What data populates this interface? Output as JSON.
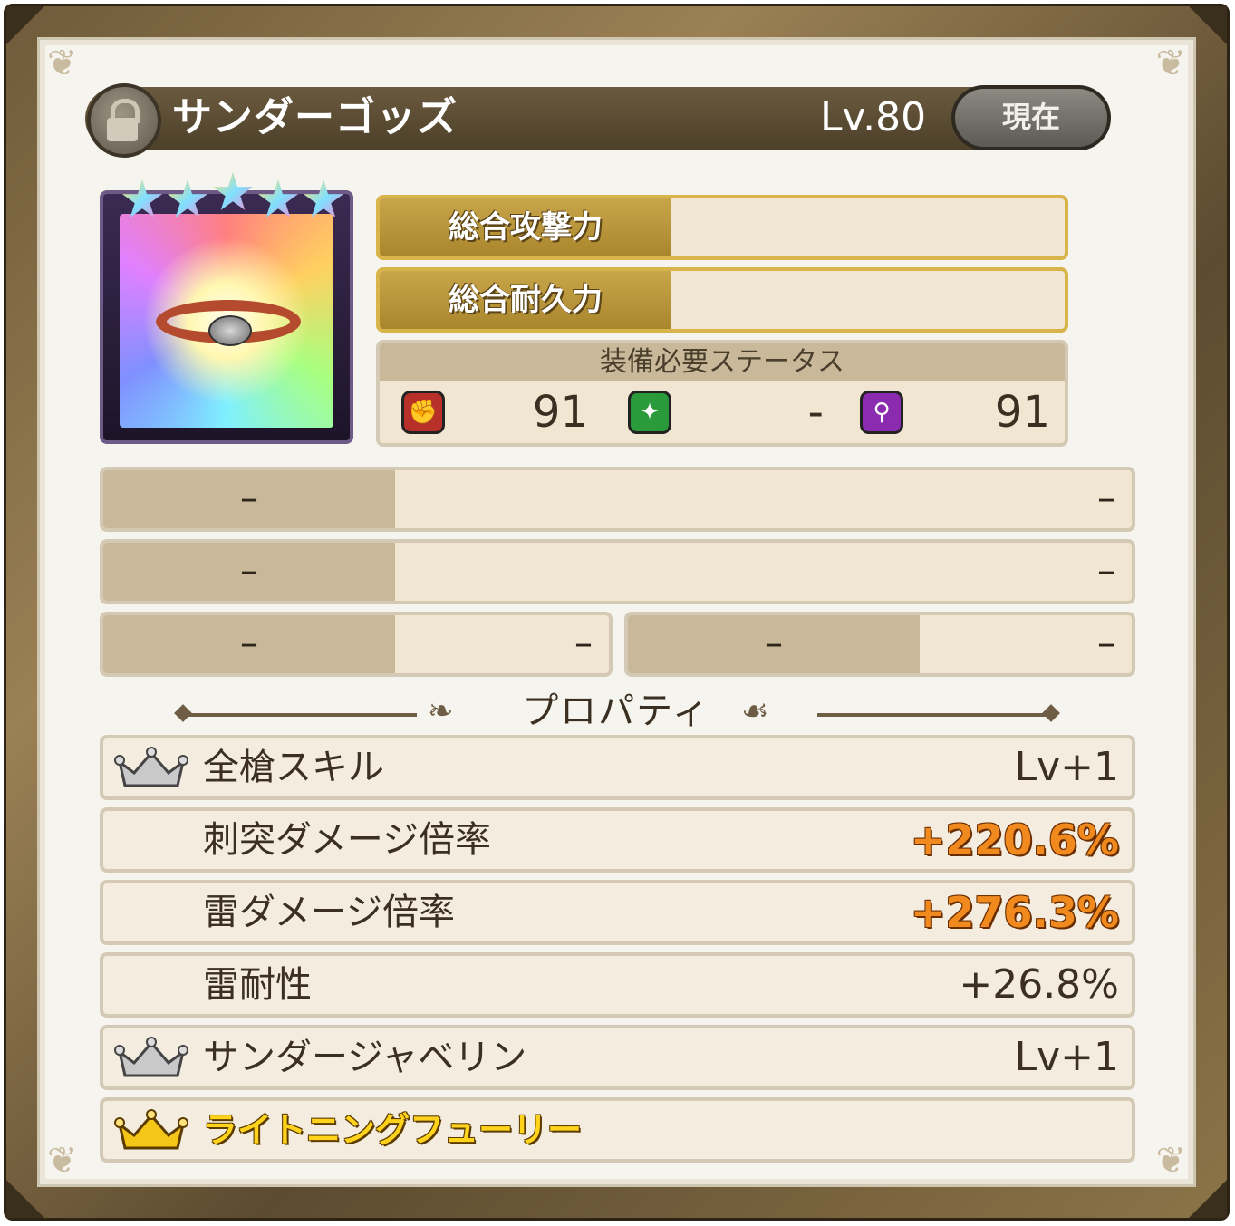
{
  "header": {
    "title": "サンダーゴッズ",
    "level": "Lv.80",
    "current_button": "現在",
    "lock_icon": "lock-icon"
  },
  "item_card": {
    "rarity_stars": 5,
    "item_icon": "belt-icon"
  },
  "stats": {
    "attack_label": "総合攻撃力",
    "durability_label": "総合耐久力"
  },
  "required_status": {
    "title": "装備必要ステータス",
    "items": [
      {
        "icon": "fist-icon",
        "value": "91"
      },
      {
        "icon": "green-star-icon",
        "value": "-"
      },
      {
        "icon": "magic-staff-icon",
        "value": "91"
      }
    ]
  },
  "slots": [
    {
      "left": "–",
      "right": "–"
    },
    {
      "left": "–",
      "right": "–"
    },
    {
      "left": "–",
      "right": "–"
    },
    {
      "left": "–",
      "right": "–"
    }
  ],
  "properties": {
    "title": "プロパティ",
    "rows": [
      {
        "name": "全槍スキル",
        "value": "Lv+1",
        "icon": "silver-crown-icon"
      },
      {
        "name": "刺突ダメージ倍率",
        "value": "+220.6%"
      },
      {
        "name": "雷ダメージ倍率",
        "value": "+276.3%"
      },
      {
        "name": "雷耐性",
        "value": "+26.8%"
      },
      {
        "name": "サンダージャベリン",
        "value": "Lv+1",
        "icon": "silver-crown-icon"
      },
      {
        "name": "ライトニングフューリー",
        "value": "",
        "icon": "gold-crown-icon"
      }
    ]
  },
  "colors": {
    "highlight_value": "#f08a1e",
    "gold_text": "#ffd21c",
    "frame": "#6f5b3a"
  }
}
